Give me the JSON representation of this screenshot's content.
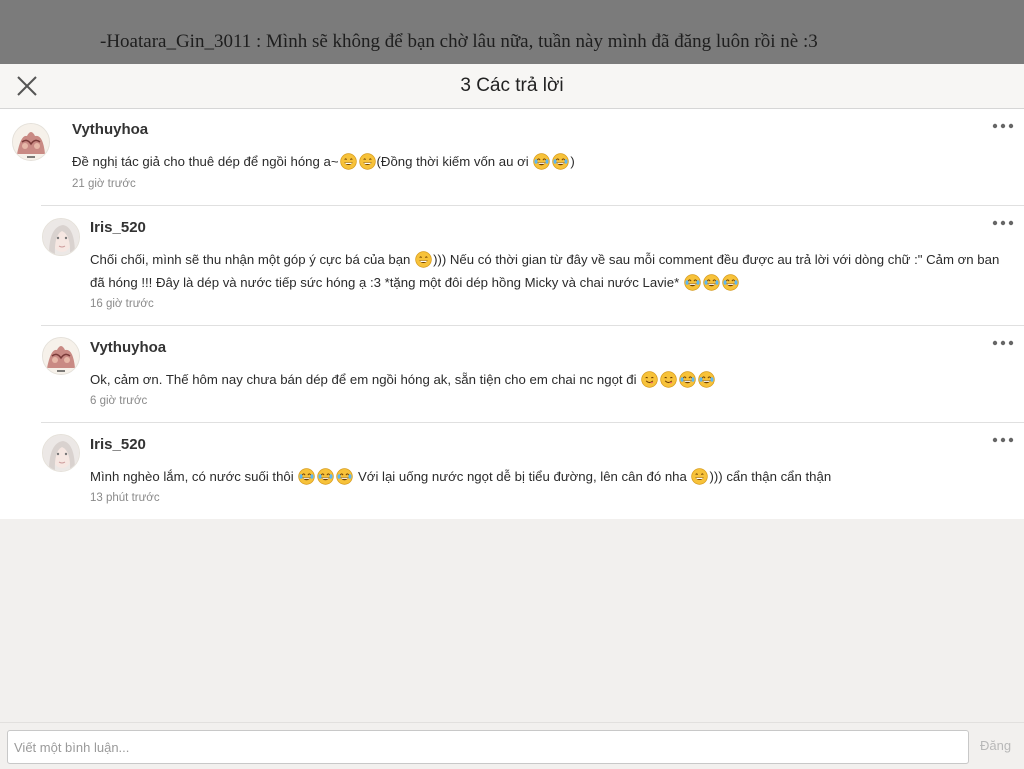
{
  "backdrop": {
    "story_text": "-Hoatara_Gin_3011 : Mình sẽ không để bạn chờ lâu nữa, tuần này mình đã đăng luôn rồi nè :3"
  },
  "header": {
    "title": "3 Các trả lời",
    "close_icon": "close-icon"
  },
  "comments": [
    {
      "user": "Vythuyhoa",
      "avatar": "avatar-illustration",
      "segments": [
        "Đề nghị tác giả cho thuê dép để ngồi hóng a~",
        "grin",
        "grin",
        "(Đồng thời kiếm vốn au ơi ",
        "joy",
        "joy",
        ")"
      ],
      "time": "21 giờ trước"
    },
    {
      "user": "Iris_520",
      "avatar": "avatar-photo",
      "segments": [
        "Chối chối, mình sẽ thu nhận một góp ý cực bá của bạn ",
        "grin",
        "))) Nếu có thời gian từ đây về sau mỗi comment đều được au trả lời với dòng chữ :\" Cảm ơn ban đã hóng !!! Đây là dép và nước tiếp sức hóng ạ :3 *tặng một đôi dép hồng Micky và chai nước Lavie* ",
        "joy",
        "joy",
        "joy"
      ],
      "time": "16 giờ trước"
    },
    {
      "user": "Vythuyhoa",
      "avatar": "avatar-illustration",
      "segments": [
        "Ok, cảm ơn. Thế hôm nay chưa bán dép để em ngồi hóng ak, sẵn tiện cho em chai nc ngọt đi ",
        "yum",
        "yum",
        "joy",
        "joy"
      ],
      "time": "6 giờ trước"
    },
    {
      "user": "Iris_520",
      "avatar": "avatar-photo",
      "segments": [
        "Mình nghèo lắm, có nước suối thôi ",
        "joy",
        "joy",
        "joy",
        " Với lại uống nước ngọt dễ bị tiểu đường, lên cân đó nha ",
        "grin",
        "))) cẩn thận cẩn thận"
      ],
      "time": "13 phút trước"
    }
  ],
  "more_icon": "more-options-icon",
  "composer": {
    "placeholder": "Viết một bình luận...",
    "post_label": "Đăng"
  },
  "colors": {
    "backdrop": "#7b7b7b",
    "panel": "#ffffff",
    "page_bg": "#f2f0ee",
    "emoji_face": "#f7c23a"
  }
}
